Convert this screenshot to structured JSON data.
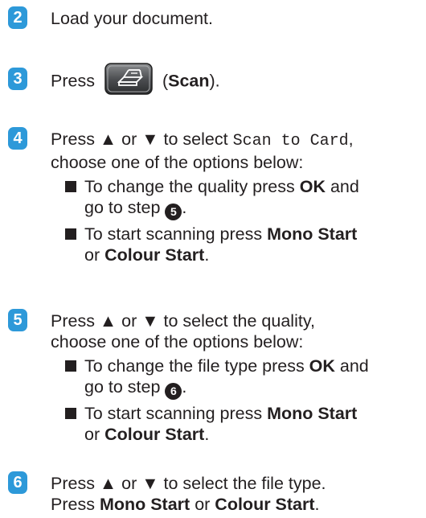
{
  "steps": [
    {
      "number": "2",
      "text": "Load your document."
    },
    {
      "number": "3",
      "prefix": "Press",
      "button_icon": "scan-button-icon",
      "paren_open": "(",
      "bold": "Scan",
      "paren_close": ")."
    },
    {
      "number": "4",
      "line1_prefix": "Press ▲ or ▼ to select ",
      "line1_code": "Scan to Card",
      "line1_suffix": ",",
      "line2": "choose one of the options below:",
      "bullets": [
        {
          "l1_pre": "To change the quality press ",
          "l1_bold": "OK",
          "l1_post": " and",
          "l2_pre": "go to step ",
          "l2_ref": "5",
          "l2_post": "."
        },
        {
          "l1_pre": "To start scanning press ",
          "l1_bold": "Mono Start",
          "l2_pre": "or ",
          "l2_bold": "Colour Start",
          "l2_post": "."
        }
      ]
    },
    {
      "number": "5",
      "line1": "Press ▲ or ▼ to select the quality,",
      "line2": "choose one of the options below:",
      "bullets": [
        {
          "l1_pre": "To change the file type press ",
          "l1_bold": "OK",
          "l1_post": " and",
          "l2_pre": "go to step ",
          "l2_ref": "6",
          "l2_post": "."
        },
        {
          "l1_pre": "To start scanning press ",
          "l1_bold": "Mono Start",
          "l2_pre": "or ",
          "l2_bold": "Colour Start",
          "l2_post": "."
        }
      ]
    },
    {
      "number": "6",
      "line1": "Press ▲ or ▼ to select the file type.",
      "line2_pre": "Press ",
      "line2_bold1": "Mono Start",
      "line2_mid": " or ",
      "line2_bold2": "Colour Start",
      "line2_post": "."
    }
  ],
  "colors": {
    "badge": "#2d99d9",
    "text": "#231f20"
  }
}
